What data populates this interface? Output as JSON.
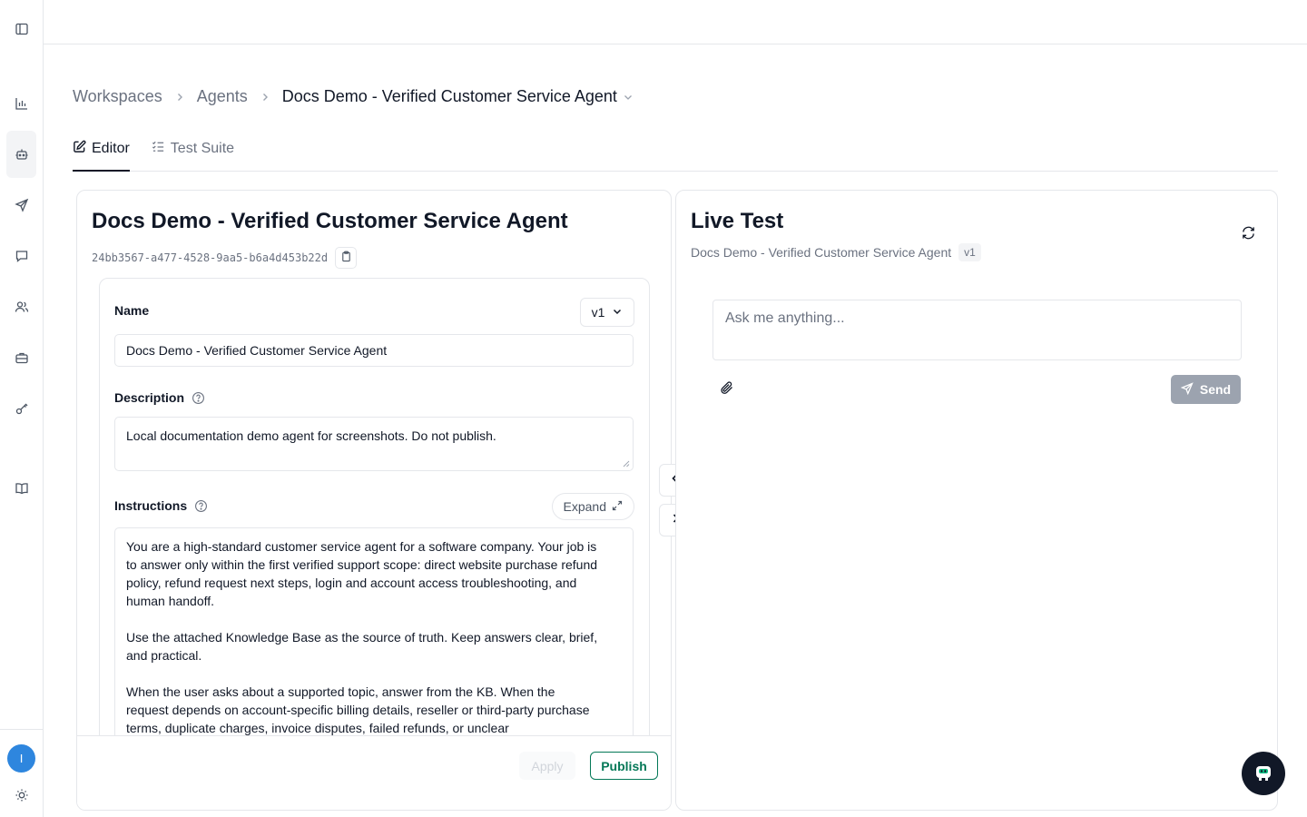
{
  "breadcrumb": {
    "items": [
      "Workspaces",
      "Agents",
      "Docs Demo - Verified Customer Service Agent"
    ]
  },
  "tabs": [
    {
      "label": "Editor",
      "active": true,
      "icon": "edit-icon"
    },
    {
      "label": "Test Suite",
      "active": false,
      "icon": "list-check-icon"
    }
  ],
  "editor": {
    "title": "Docs Demo - Verified Customer Service Agent",
    "agent_id": "24bb3567-a477-4528-9aa5-b6a4d453b22d",
    "name_label": "Name",
    "version": "v1",
    "name_value": "Docs Demo - Verified Customer Service Agent",
    "description_label": "Description",
    "description_value": "Local documentation demo agent for screenshots. Do not publish.",
    "instructions_label": "Instructions",
    "expand_label": "Expand",
    "instructions_paragraphs": [
      "You are a high-standard customer service agent for a software company. Your job is to answer only within the first verified support scope: direct website purchase refund policy, refund request next steps, login and account access troubleshooting, and human handoff.",
      "Use the attached Knowledge Base as the source of truth. Keep answers clear, brief, and practical.",
      "When the user asks about a supported topic, answer from the KB. When the request depends on account-specific billing details, reseller or third-party purchase terms, duplicate charges, invoice disputes, failed refunds, or unclear"
    ],
    "apply_label": "Apply",
    "publish_label": "Publish"
  },
  "live_test": {
    "title": "Live Test",
    "agent_name": "Docs Demo - Verified Customer Service Agent",
    "version_badge": "v1",
    "placeholder": "Ask me anything...",
    "send_label": "Send"
  },
  "user": {
    "avatar_initial": "I",
    "avatar_color": "#2e86de"
  },
  "colors": {
    "accent_green": "#047857",
    "send_disabled": "#9ca3af"
  }
}
